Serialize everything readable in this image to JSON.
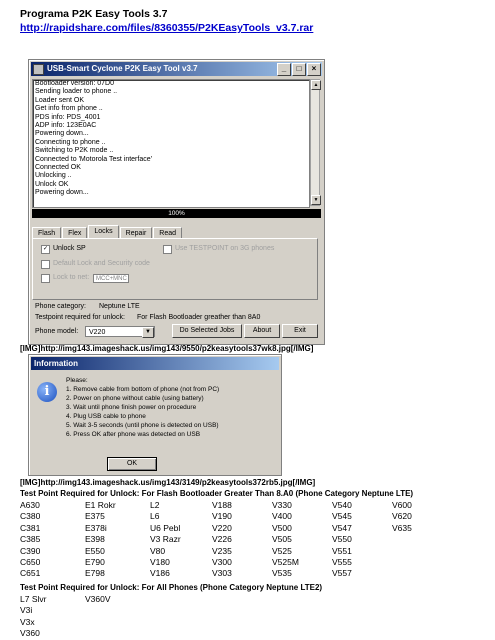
{
  "doc": {
    "title": "Programa P2K Easy Tools 3.7",
    "link": "http://rapidshare.com/files/8360355/P2KEasyTools_v3.7.rar"
  },
  "window": {
    "title": "USB-Smart Cyclone  P2K Easy Tool v3.7",
    "btn_min": "_",
    "btn_max": "□",
    "btn_close": "×",
    "log": [
      "Bootloader version: 07D0",
      "Sending loader to phone ..",
      "Loader sent OK",
      "Get info from phone ..",
      "PDS info: PDS_4001",
      "ADP info: 123E0AC",
      "Powering down...",
      "Connecting to phone ..",
      "Switching to P2K mode ..",
      "Connected to 'Motorola Test interface'",
      "Connected OK",
      "Unlocking ..",
      "Unlock OK",
      "Powering down..."
    ],
    "progress_label": "100%",
    "progress_value": 1.0,
    "tabs": [
      "Flash",
      "Flex",
      "Locks",
      "Repair",
      "Read"
    ],
    "active_tab": "Locks",
    "locks": {
      "unlock_sp": "Unlock SP",
      "use_testpoint": "Use TESTPOINT on 3G phones",
      "default_lock": "Default Lock and Security code",
      "lock_to_net": "Lock to net:",
      "lock_to_net_value": "MCC+MNC"
    },
    "phone_category_label": "Phone category:",
    "phone_category_value": "Neptune LTE",
    "testpoint_label": "Testpoint required for unlock:",
    "testpoint_value": "For Flash Bootloader greather than 8A0",
    "phone_model_label": "Phone model:",
    "phone_model_value": "V220",
    "btn_do_selected": "Do Selected Jobs",
    "btn_about": "About",
    "btn_exit": "Exit"
  },
  "caption1": "[IMG]http://img143.imageshack.us/img143/9550/p2keasytools37wk8.jpg[/IMG]",
  "dialog": {
    "title": "Information",
    "icon": "info-icon",
    "lines": [
      "Please:",
      "1. Remove cable from bottom of phone (not from PC)",
      "2. Power on phone without cable (using battery)",
      "3. Wait until phone finish power on procedure",
      "4. Plug USB cable to phone",
      "5. Wait 3-5 seconds (until phone is detected on USB)",
      "6. Press OK after phone was detected on USB"
    ],
    "ok": "OK"
  },
  "caption2": "[IMG]http://img143.imageshack.us/img143/3149/p2keasytools372rb5.jpg[/IMG]",
  "section1": {
    "heading": "Test Point Required for Unlock: For Flash Bootloader Greater Than 8.A0 (Phone Category Neptune LTE)",
    "rows": [
      [
        "A630",
        "E1 Rokr",
        "L2",
        "V188",
        "V330",
        "V540",
        "V600"
      ],
      [
        "C380",
        "E375",
        "L6",
        "V190",
        "V400",
        "V545",
        "V620"
      ],
      [
        "C381",
        "E378i",
        "U6 Pebl",
        "V220",
        "V500",
        "V547",
        "V635"
      ],
      [
        "C385",
        "E398",
        "V3 Razr",
        "V226",
        "V505",
        "V550",
        ""
      ],
      [
        "C390",
        "E550",
        "V80",
        "V235",
        "V525",
        "V551",
        ""
      ],
      [
        "C650",
        "E790",
        "V180",
        "V300",
        "V525M",
        "V555",
        ""
      ],
      [
        "C651",
        "E798",
        "V186",
        "V303",
        "V535",
        "V557",
        ""
      ]
    ]
  },
  "section2": {
    "heading": "Test Point Required for Unlock: For All Phones (Phone Category Neptune LTE2)",
    "rows": [
      [
        "L7 Slvr",
        "V360V"
      ],
      [
        "V3i",
        ""
      ],
      [
        "V3x",
        ""
      ],
      [
        "V360",
        ""
      ]
    ]
  }
}
